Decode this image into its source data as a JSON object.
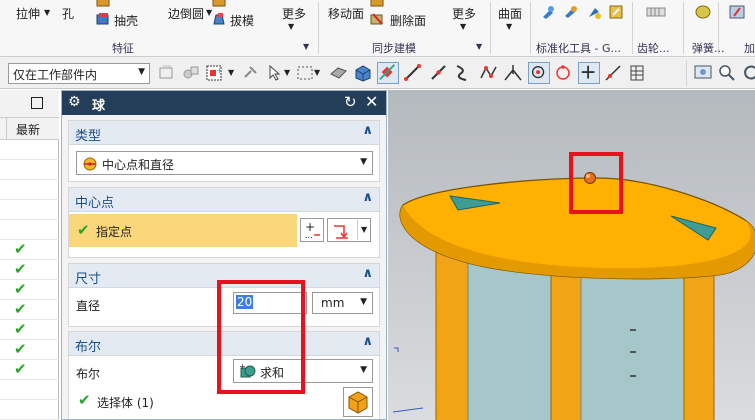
{
  "ribbon": {
    "top_row": [
      "拉伸",
      "孔",
      "边倒圆",
      "更多",
      "移动面",
      "更多",
      "曲面"
    ],
    "middle_row": [
      "抽壳",
      "拔模",
      "删除面"
    ],
    "groups": [
      "特征",
      "同步建模",
      "标准化工具 - G...",
      "齿轮...",
      "弹簧...",
      "加"
    ]
  },
  "selection_bar": {
    "scope": "仅在工作部件内"
  },
  "navigator": {
    "column_header": "最新",
    "rows_checked": 7
  },
  "dialog": {
    "title": "球",
    "type_section": {
      "header": "类型",
      "value": "中心点和直径"
    },
    "center_section": {
      "header": "中心点",
      "specify_label": "指定点"
    },
    "size_section": {
      "header": "尺寸",
      "diameter_label": "直径",
      "diameter_value": "20",
      "unit": "mm"
    },
    "boolean_section": {
      "header": "布尔",
      "boolean_label": "布尔",
      "boolean_value": "求和",
      "select_body_label": "选择体 (1)"
    }
  },
  "colors": {
    "title_bar": "#243e5a",
    "section_header_text": "#1a4f8a",
    "highlight_row": "#f9d77a",
    "accent_red": "#e8121c",
    "model_orange": "#ffb000"
  }
}
